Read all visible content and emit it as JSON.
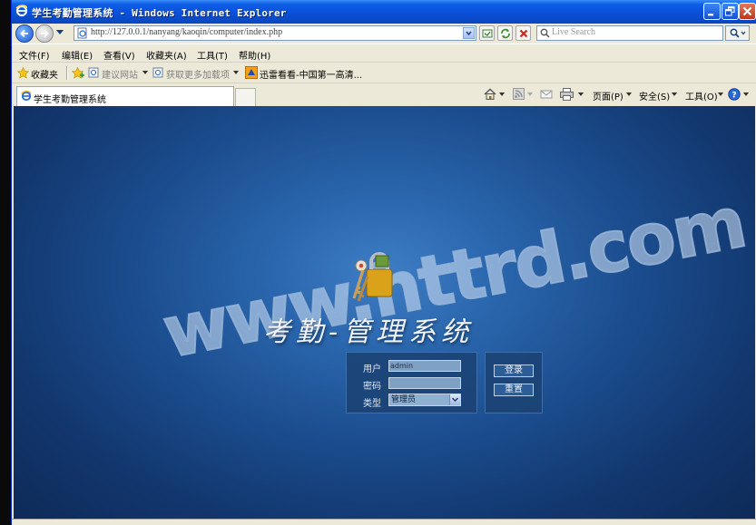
{
  "window": {
    "title": "学生考勤管理系统 - Windows Internet Explorer",
    "accent": "#0a4fd4"
  },
  "address": {
    "url": "http://127.0.0.1/nanyang/kaoqin/computer/index.php",
    "search_placeholder": "Live Search"
  },
  "menu": [
    "文件(F)",
    "编辑(E)",
    "查看(V)",
    "收藏夹(A)",
    "工具(T)",
    "帮助(H)"
  ],
  "favorites": {
    "label": "收藏夹",
    "items": [
      "建议网站",
      "获取更多加载项",
      "迅雷看看-中国第一高清..."
    ]
  },
  "tab": {
    "label": "学生考勤管理系统"
  },
  "commands": {
    "page": "页面(P)",
    "safety": "安全(S)",
    "tools": "工具(O)"
  },
  "page": {
    "watermark": "www.httrd.com",
    "logo": "考勤-管理系统",
    "login": {
      "user_label": "用户",
      "user_value": "admin",
      "password_label": "密码",
      "type_label": "类型",
      "type_value": "管理员",
      "login_button": "登录",
      "reset_button": "重置"
    }
  }
}
